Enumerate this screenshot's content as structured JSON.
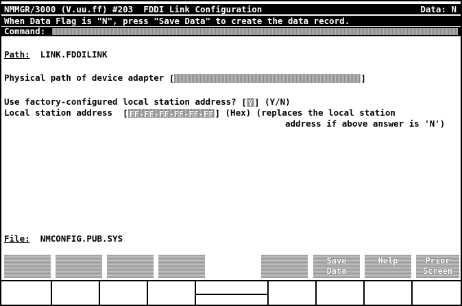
{
  "header": {
    "title": "NMMGR/3000 (V.uu.ff) #203  FDDI Link Configuration",
    "data_flag": "Data: N",
    "message": "When Data Flag is \"N\", press \"Save Data\" to create the data record.",
    "command_label": "Command:"
  },
  "path": {
    "label": "Path:",
    "value": "LINK.FDDILINK"
  },
  "physical_path": {
    "label": "Physical path of device adapter",
    "value": ""
  },
  "factory_addr": {
    "label": "Use factory-configured local station address?",
    "value": "Y",
    "hint": "(Y/N)"
  },
  "local_addr": {
    "label": "Local station address",
    "value": "FF-FF-FF-FF-FF-FF",
    "hint1": "(Hex) (replaces the local station",
    "hint2": "address if above answer is 'N')"
  },
  "file": {
    "label": "File:",
    "value": "NMCONFIG.PUB.SYS"
  },
  "function_keys": [
    {
      "line1": "",
      "line2": ""
    },
    {
      "line1": "",
      "line2": ""
    },
    {
      "line1": "",
      "line2": ""
    },
    {
      "line1": "",
      "line2": ""
    },
    {
      "line1": "",
      "line2": ""
    },
    {
      "line1": "",
      "line2": ""
    },
    {
      "line1": "Save",
      "line2": "Data"
    },
    {
      "line1": "Help",
      "line2": ""
    },
    {
      "line1": "Prior",
      "line2": "Screen"
    }
  ]
}
